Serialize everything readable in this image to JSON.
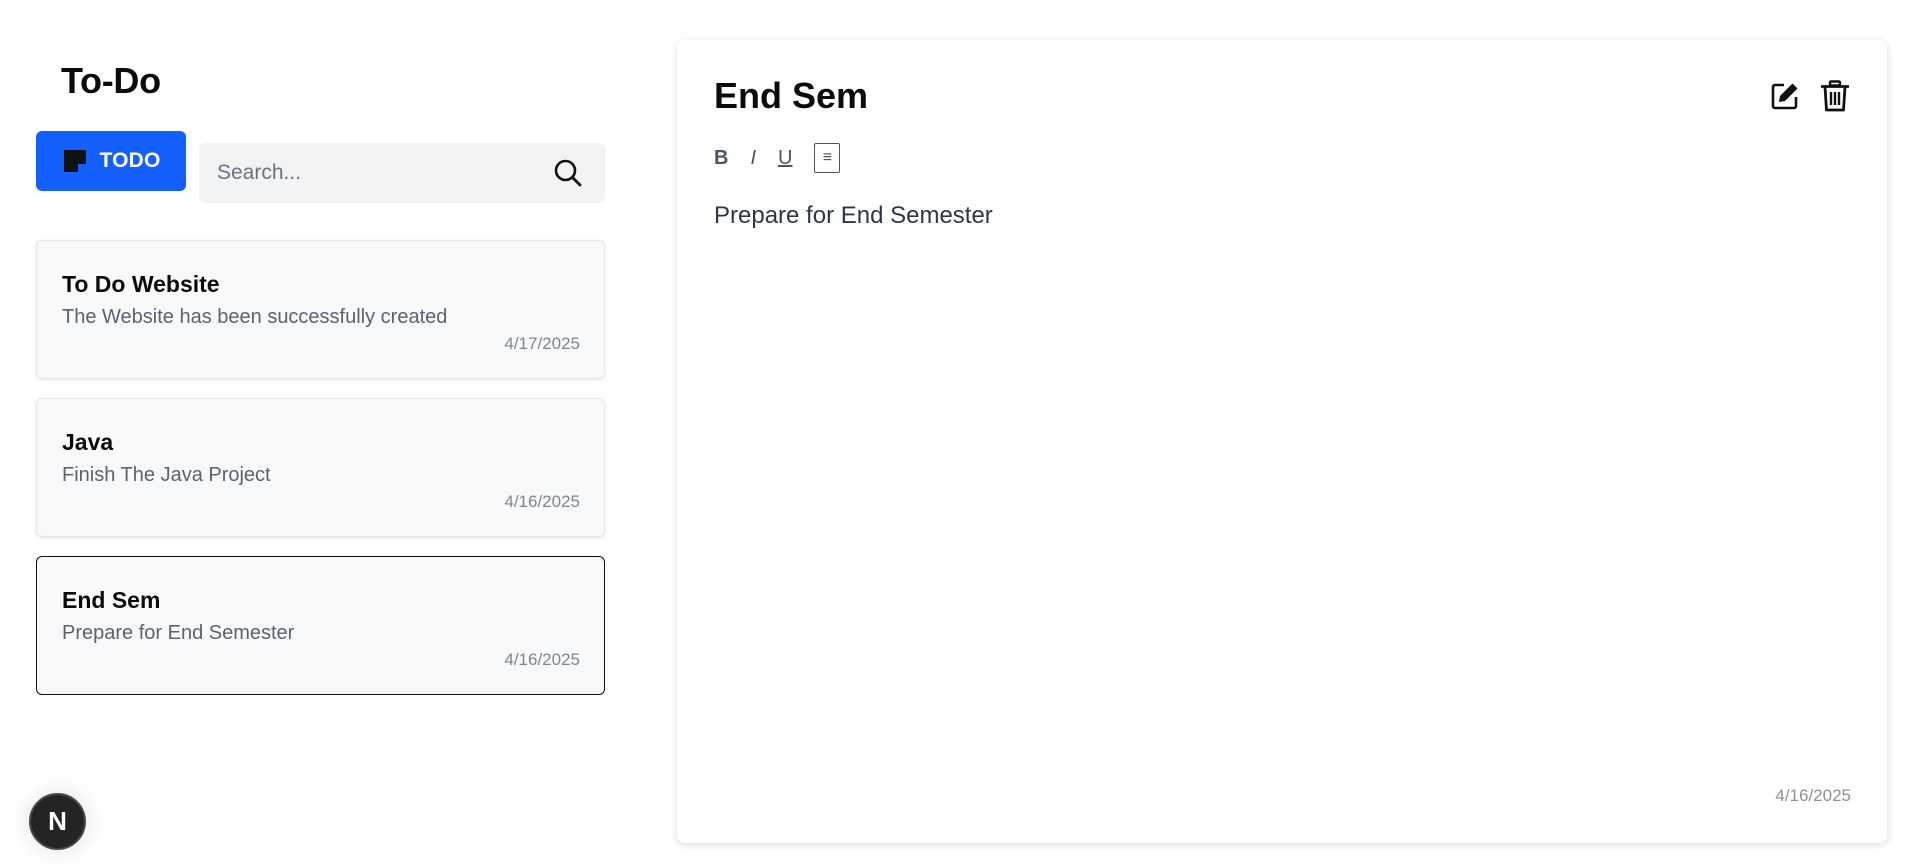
{
  "app": {
    "title": "To-Do"
  },
  "new_button": {
    "label": "TODO",
    "icon": "sticky-note-icon",
    "color": "#1360ff"
  },
  "search": {
    "placeholder": "Search...",
    "value": "",
    "icon": "search-icon"
  },
  "notes": [
    {
      "title": "To Do Website",
      "description": "The Website has been successfully created",
      "date": "4/17/2025",
      "selected": false
    },
    {
      "title": "Java",
      "description": "Finish The Java Project",
      "date": "4/16/2025",
      "selected": false
    },
    {
      "title": "End Sem",
      "description": "Prepare for End Semester",
      "date": "4/16/2025",
      "selected": true
    }
  ],
  "editor": {
    "title": "End Sem",
    "body": "Prepare for End Semester",
    "date": "4/16/2025",
    "actions": {
      "edit_icon": "edit-icon",
      "delete_icon": "trash-icon"
    },
    "toolbar": {
      "bold": "B",
      "italic": "I",
      "underline": "U",
      "list": "≡"
    }
  },
  "avatar": {
    "letter": "N"
  }
}
